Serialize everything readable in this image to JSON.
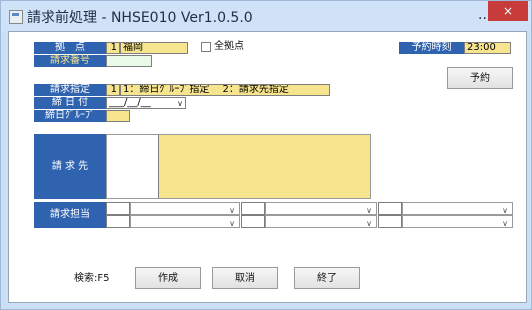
{
  "window": {
    "title": "請求前処理 - NHSE010 Ver1.0.5.0",
    "more_label": "...",
    "close_label": "×"
  },
  "form": {
    "kyoten_label": "拠　点",
    "kyoten_code": "1",
    "kyoten_name": "福岡",
    "all_kyoten_label": "全拠点",
    "seikyu_bango_label": "請求番号",
    "seikyu_shitei_label": "請求指定",
    "seikyu_shitei_code": "1",
    "seikyu_shitei_options": "1：締日ｸﾞﾙｰﾌﾟ指定　 2：請求先指定",
    "shimebi_label": "締 日 付",
    "shimebi_value": "___/__/__",
    "shimebi_group_label": "締日ｸﾞﾙｰﾌﾟ",
    "yoyaku_time_label": "予約時刻",
    "yoyaku_time_value": "23:00",
    "yoyaku_button": "予約",
    "seikyusaki_label": "請 求 先",
    "seikyu_tanto_label": "請求担当"
  },
  "footer": {
    "search_hint": "検索:F5",
    "create_button": "作成",
    "cancel_button": "取消",
    "exit_button": "終了"
  },
  "icons": {
    "dropdown": "chevron-down-icon",
    "app": "window-app-icon",
    "close": "close-icon"
  }
}
